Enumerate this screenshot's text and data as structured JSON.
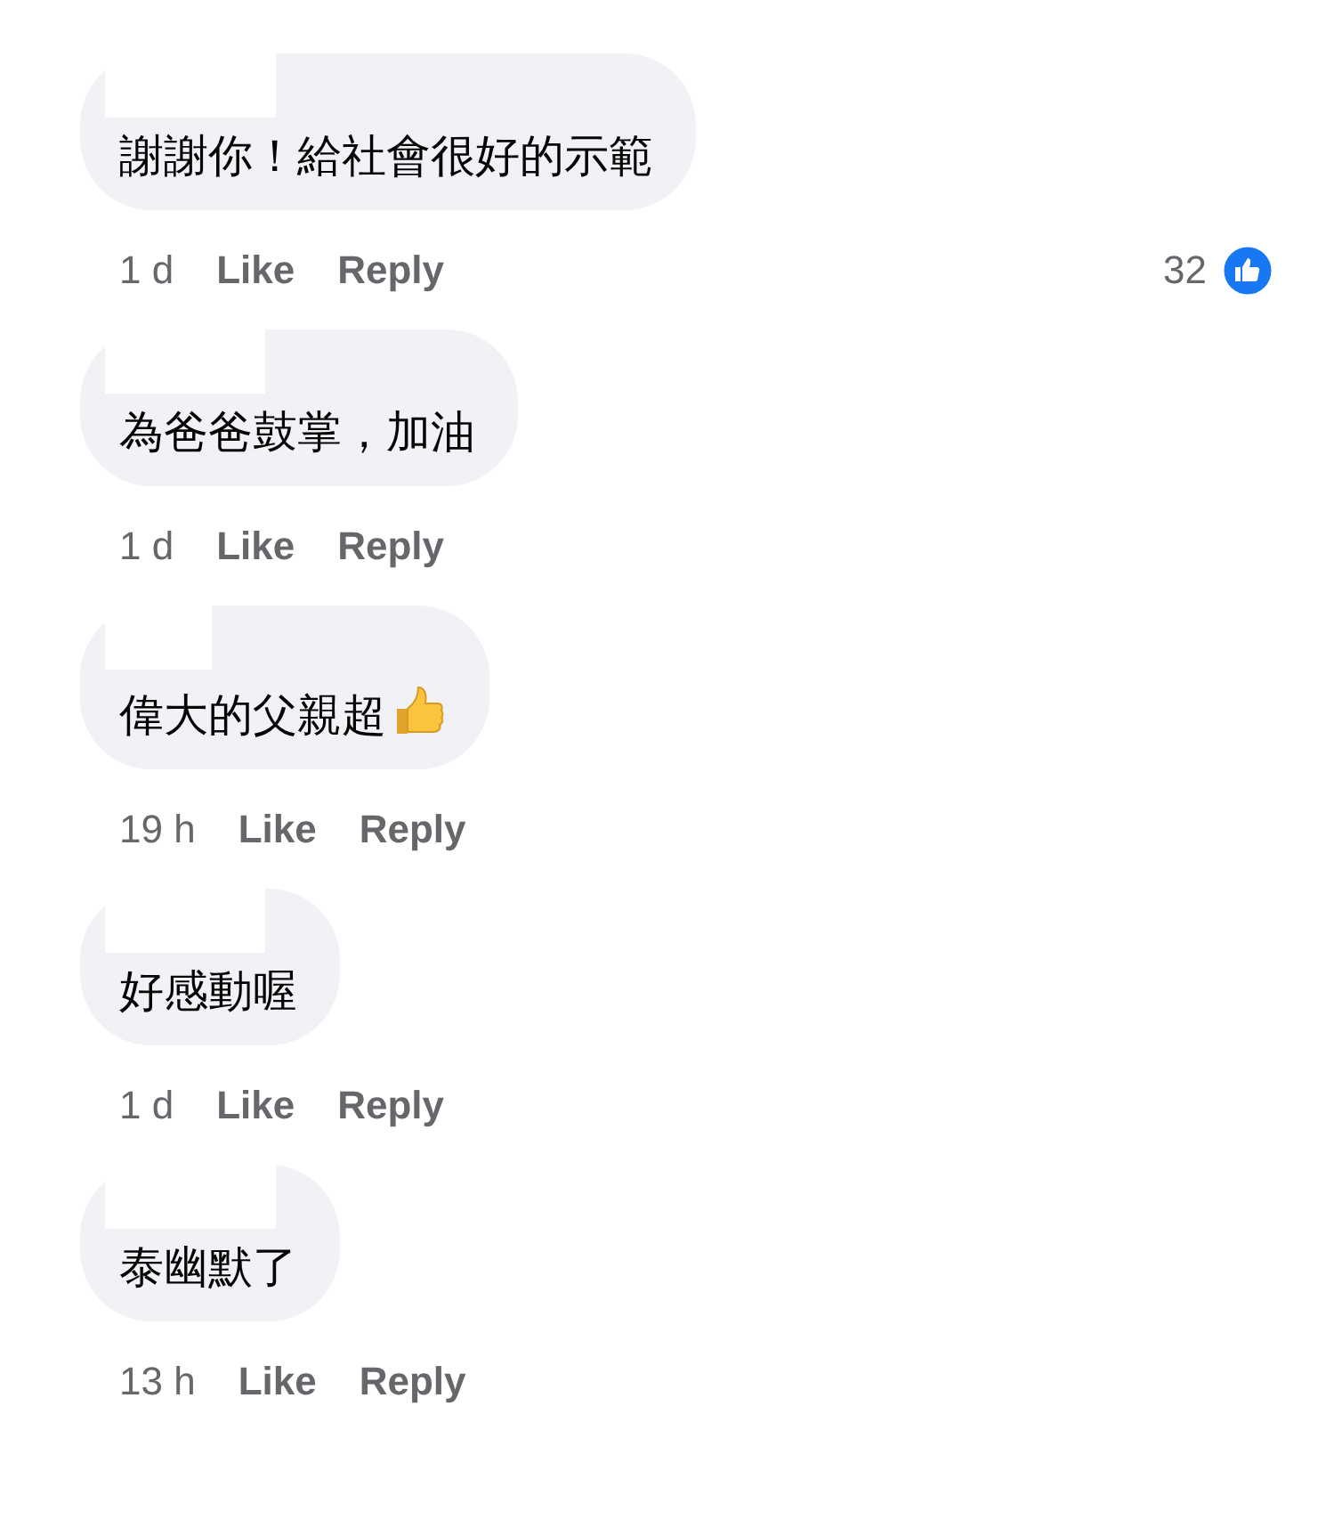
{
  "comments": [
    {
      "kind": "plain",
      "text": "謝謝你！給社會很好的示範",
      "time": "1 d",
      "like": "Like",
      "reply": "Reply",
      "reactions": {
        "count": "32"
      }
    },
    {
      "kind": "plain",
      "text": "為爸爸鼓掌，加油",
      "time": "1 d",
      "like": "Like",
      "reply": "Reply"
    },
    {
      "kind": "emoji",
      "text": "偉大的父親超",
      "time": "19 h",
      "like": "Like",
      "reply": "Reply"
    },
    {
      "kind": "plain",
      "text": "好感動喔",
      "time": "1 d",
      "like": "Like",
      "reply": "Reply"
    },
    {
      "kind": "plain",
      "text": "泰幽默了",
      "time": "13 h",
      "like": "Like",
      "reply": "Reply"
    }
  ]
}
